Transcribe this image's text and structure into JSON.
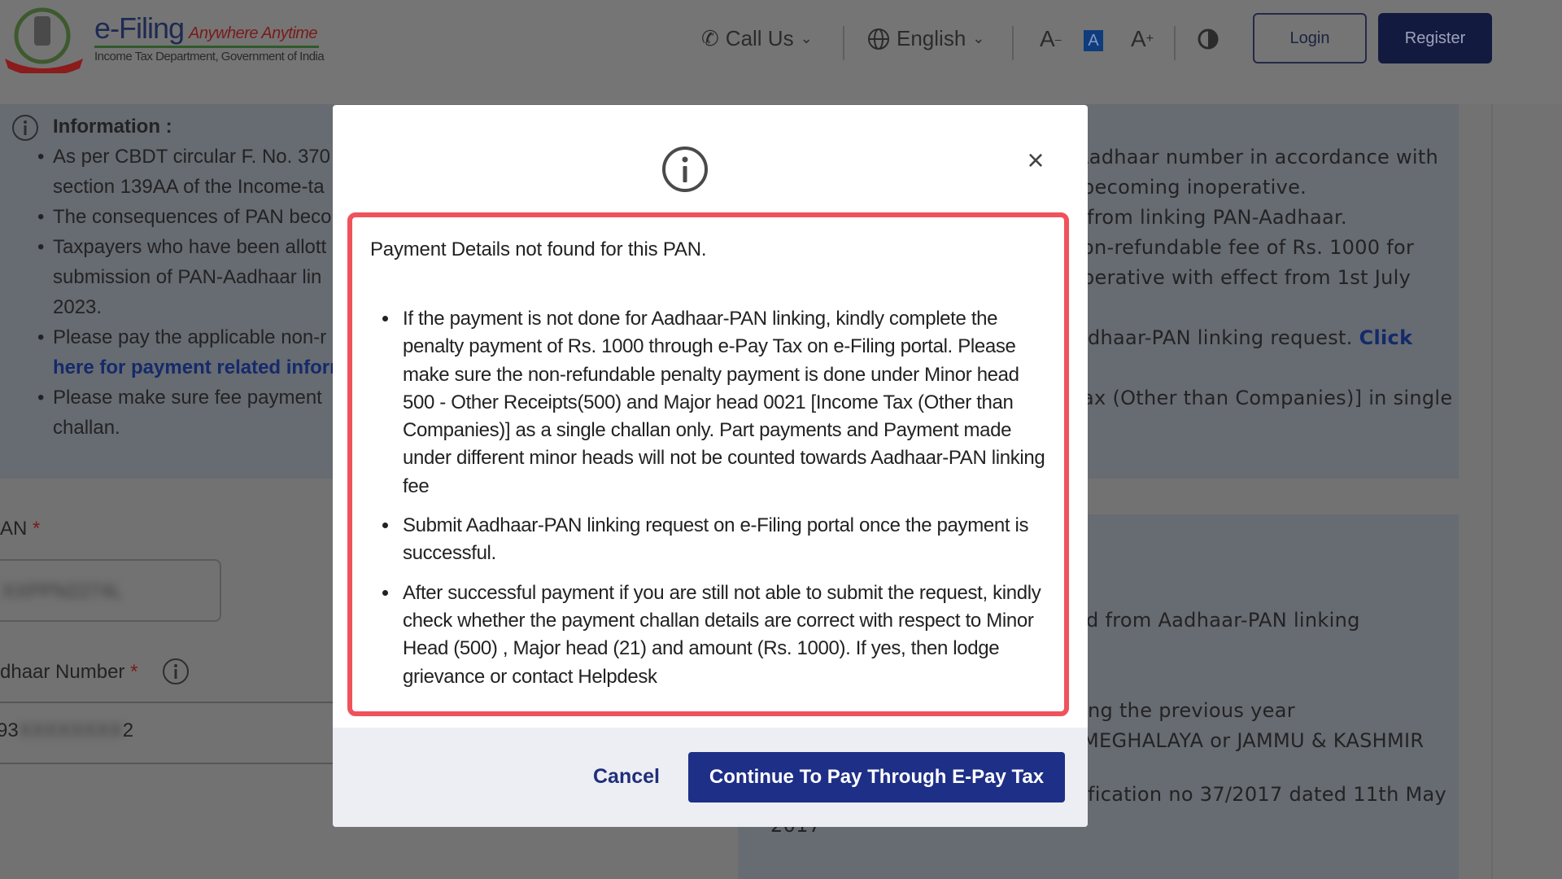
{
  "header": {
    "brand": "e-Filing",
    "tagline": "Anywhere Anytime",
    "department": "Income Tax Department, Government of India",
    "call_us": "Call Us",
    "language": "English",
    "font_decrease": "A",
    "font_default": "A",
    "font_increase": "A",
    "login": "Login",
    "register": "Register"
  },
  "background": {
    "info_heading": "Information :",
    "left_lines": [
      "As per CBDT circular F. No. 370",
      "section 139AA of the Income-ta",
      "The consequences of PAN beco",
      "Taxpayers who have been allott",
      "submission of PAN-Aadhaar lin",
      "2023.",
      "Please pay the applicable non-r",
      "here for payment related inform",
      "Please make sure fee payment",
      "challan."
    ],
    "right_lines": [
      "Aadhaar number in accordance with",
      "becoming inoperative.",
      "from linking PAN-Aadhaar.",
      "on-refundable fee of Rs. 1000 for",
      "perative with effect from 1st July",
      "adhaar-PAN linking request.",
      "ax (Other than Companies)] in single"
    ],
    "right_link": "Click",
    "pan_label": "AN",
    "aadhaar_label": "dhaar Number",
    "required_mark": "*",
    "pan_value": "XXPPN2274L",
    "aadhaar_value_start": "93",
    "aadhaar_value_mid": "XXXXXXXX",
    "aadhaar_value_end": "2",
    "right_lower_lines": [
      "d from Aadhaar-PAN linking",
      "ng the previous year",
      "MEGHALAYA or JAMMU & KASHMIR",
      "fication no 37/2017 dated 11th May",
      "2017"
    ]
  },
  "modal": {
    "title": "Payment Details not found for this PAN.",
    "bullets": [
      "If the payment is not done for Aadhaar-PAN linking, kindly complete the penalty payment of Rs. 1000 through e-Pay Tax on e-Filing portal. Please make sure the non-refundable penalty payment is done under Minor head 500 - Other Receipts(500) and Major head 0021 [Income Tax (Other than Companies)] as a single challan only. Part payments and Payment made under different minor heads will not be counted towards Aadhaar-PAN linking fee",
      "Submit Aadhaar-PAN linking request on e-Filing portal once the payment is successful.",
      "After successful payment if you are still not able to submit the request, kindly check whether the payment challan details are correct with respect to Minor Head (500) , Major head (21) and amount (Rs. 1000). If yes, then lodge grievance or contact Helpdesk"
    ],
    "close": "×",
    "cancel": "Cancel",
    "continue": "Continue To Pay Through E-Pay Tax"
  },
  "colors": {
    "highlight_border": "#f0525c",
    "primary": "#1e2f87",
    "overlay": "#727272"
  }
}
